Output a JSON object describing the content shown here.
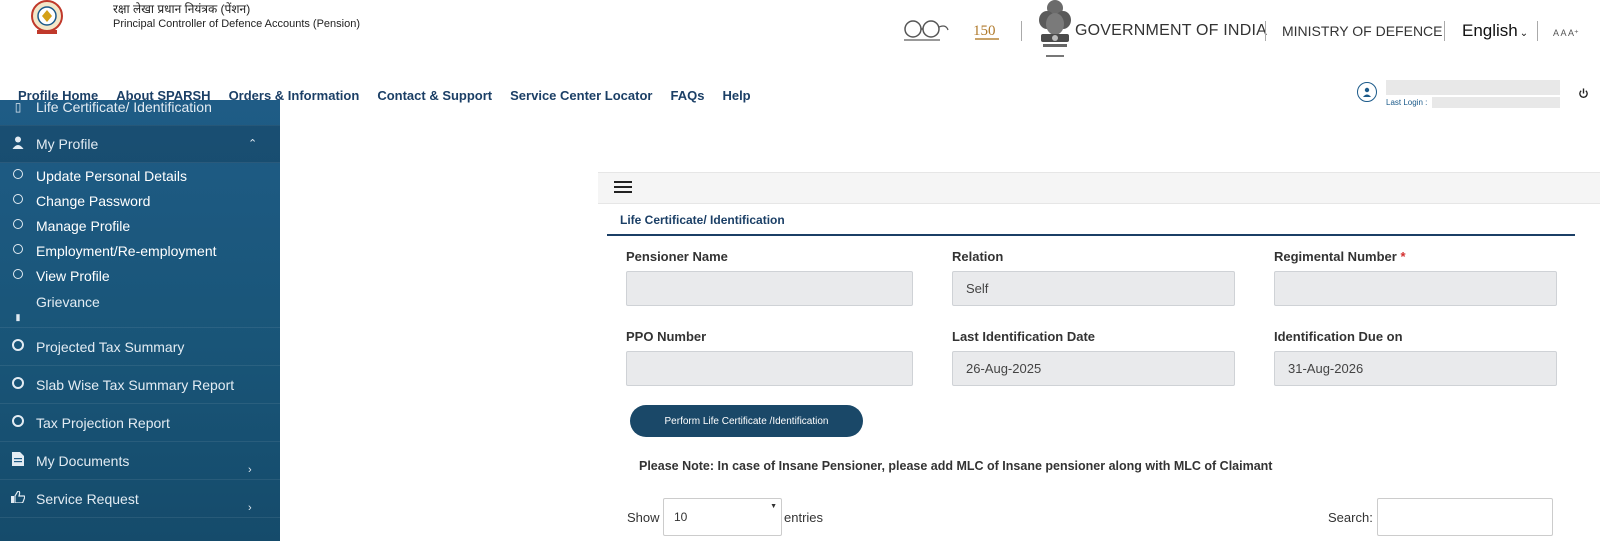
{
  "header": {
    "org_hindi": "रक्षा लेखा प्रधान नियंत्रक (पेंशन)",
    "org_english": "Principal Controller of Defence Accounts (Pension)",
    "gov_title": "GOVERNMENT OF INDIA",
    "ministry": "MINISTRY OF DEFENCE",
    "language": "English",
    "font_size_controls": "A A A⁺"
  },
  "nav": {
    "items": [
      "Profile Home",
      "About SPARSH",
      "Orders & Information",
      "Contact & Support",
      "Service Center Locator",
      "FAQs",
      "Help"
    ]
  },
  "user": {
    "last_login_label": "Last Login :"
  },
  "sidebar": {
    "items": [
      {
        "label": "Life Certificate/ Identification"
      },
      {
        "label": "My Profile"
      },
      {
        "label": "Update Personal Details"
      },
      {
        "label": "Change Password"
      },
      {
        "label": "Manage Profile"
      },
      {
        "label": "Employment/Re-employment"
      },
      {
        "label": "View Profile"
      },
      {
        "label": "Grievance"
      },
      {
        "label": "Projected Tax Summary"
      },
      {
        "label": "Slab Wise Tax Summary Report"
      },
      {
        "label": "Tax Projection Report"
      },
      {
        "label": "My Documents"
      },
      {
        "label": "Service Request"
      }
    ]
  },
  "content": {
    "section_title": "Life Certificate/ Identification",
    "fields": {
      "pensioner_name": {
        "label": "Pensioner Name",
        "value": ""
      },
      "relation": {
        "label": "Relation",
        "value": "Self"
      },
      "regimental_number": {
        "label": "Regimental Number",
        "required_mark": "*",
        "value": ""
      },
      "ppo_number": {
        "label": "PPO Number",
        "value": ""
      },
      "last_identification_date": {
        "label": "Last Identification Date",
        "value": "26-Aug-2025"
      },
      "identification_due_on": {
        "label": "Identification Due on",
        "value": "31-Aug-2026"
      }
    },
    "perform_button": "Perform Life Certificate /Identification",
    "note": "Please Note: In case of Insane Pensioner, please add MLC of Insane pensioner along with MLC of Claimant",
    "table_controls": {
      "show_label": "Show",
      "entries_value": "10",
      "entries_label": "entries",
      "search_label": "Search:"
    }
  },
  "colors": {
    "brand_navy": "#1b3f66",
    "sidebar_blue": "#1f5c86",
    "button_navy": "#1a4868",
    "required_red": "#d32f2f"
  }
}
